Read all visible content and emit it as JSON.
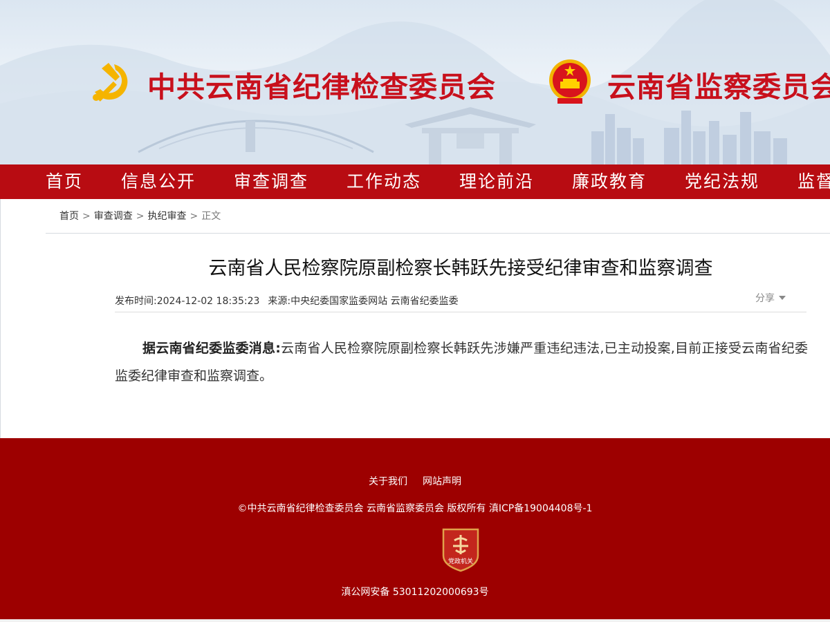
{
  "header": {
    "org_name_1": "中共云南省纪律检查委员会",
    "org_name_2": "云南省监察委员会",
    "emblem_left": "party-emblem-icon",
    "emblem_right": "national-emblem-icon"
  },
  "nav": {
    "items": [
      {
        "label": "首页"
      },
      {
        "label": "信息公开"
      },
      {
        "label": "审查调查"
      },
      {
        "label": "工作动态"
      },
      {
        "label": "理论前沿"
      },
      {
        "label": "廉政教育"
      },
      {
        "label": "党纪法规"
      },
      {
        "label": "监督"
      }
    ]
  },
  "breadcrumb": {
    "items": [
      "首页",
      "审查调查",
      "执纪审查"
    ],
    "separator": ">",
    "current": "正文"
  },
  "article": {
    "title": "云南省人民检察院原副检察长韩跃先接受纪律审查和监察调查",
    "published_label": "发布时间:",
    "published_value": "2024-12-02 18:35:23",
    "source_label": "来源:",
    "source_value": "中央纪委国家监委网站 云南省纪委监委",
    "share_label": "分享",
    "lead": "据云南省纪委监委消息:",
    "body": "云南省人民检察院原副检察长韩跃先涉嫌严重违纪违法,已主动投案,目前正接受云南省纪委监委纪律审查和监察调查。"
  },
  "footer": {
    "links": [
      {
        "label": "关于我们"
      },
      {
        "label": "网站声明"
      }
    ],
    "copyright": "©中共云南省纪律检查委员会 云南省监察委员会 版权所有 滇ICP备19004408号-1",
    "badge_text": "党政机关",
    "police_record": "滇公网安备 53011202000693号"
  },
  "colors": {
    "brand_red": "#c8101c",
    "nav_red": "#b80c12",
    "footer_red": "#9d0000",
    "gold": "#f5b400"
  }
}
